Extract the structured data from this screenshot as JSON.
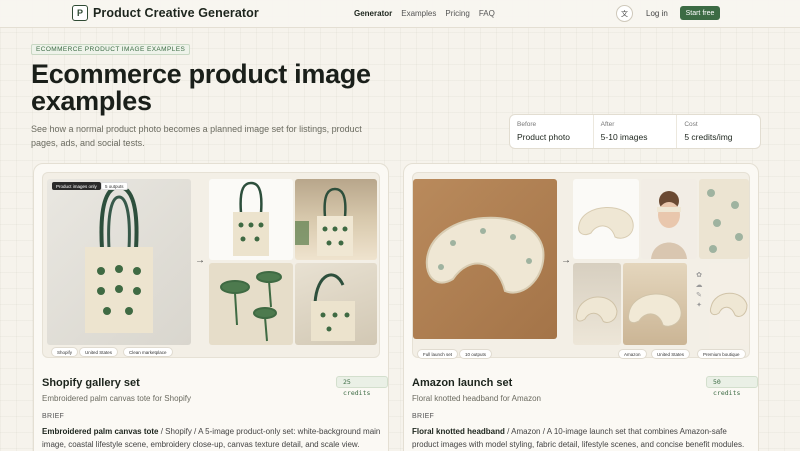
{
  "nav": {
    "logo_letter": "P",
    "brand": "Product Creative Generator",
    "links": [
      "Generator",
      "Examples",
      "Pricing",
      "FAQ"
    ],
    "lang_icon": "translate-icon",
    "lang_glyph": "文",
    "login": "Log in",
    "start": "Start free"
  },
  "hero": {
    "eyebrow": "ECOMMERCE PRODUCT IMAGE EXAMPLES",
    "title": "Ecommerce product image examples",
    "subtitle": "See how a normal product photo becomes a planned image set for listings, product pages, ads, and social tests."
  },
  "stats": [
    {
      "label": "Before",
      "value": "Product photo"
    },
    {
      "label": "After",
      "value": "5-10 images"
    },
    {
      "label": "Cost",
      "value": "5 credits/img"
    }
  ],
  "cards": [
    {
      "tag_primary": "Product images only",
      "tag_count": "5 outputs",
      "pills": [
        "Shopify",
        "United States",
        "Clean marketplace"
      ],
      "title": "Shopify gallery set",
      "credits": "25 credits",
      "desc": "Embroidered palm canvas tote for Shopify",
      "brief_label": "BRIEF",
      "brief_bold": "Embroidered palm canvas tote",
      "brief_rest": " / Shopify / A 5-image product-only set: white-background main image, coastal lifestyle scene, embroidery close-up, canvas texture detail, and scale view."
    },
    {
      "tag_primary": "Full launch set",
      "tag_count": "10 outputs",
      "pills": [
        "Amazon",
        "United States",
        "Premium boutique"
      ],
      "title": "Amazon launch set",
      "credits": "50 credits",
      "desc": "Floral knotted headband for Amazon",
      "brief_label": "BRIEF",
      "brief_bold": "Floral knotted headband",
      "brief_rest": " / Amazon / A 10-image launch set that combines Amazon-safe product images with model styling, fabric detail, lifestyle scenes, and concise benefit modules."
    }
  ],
  "colors": {
    "accent": "#3c6b44",
    "background": "#f6f3ec"
  }
}
